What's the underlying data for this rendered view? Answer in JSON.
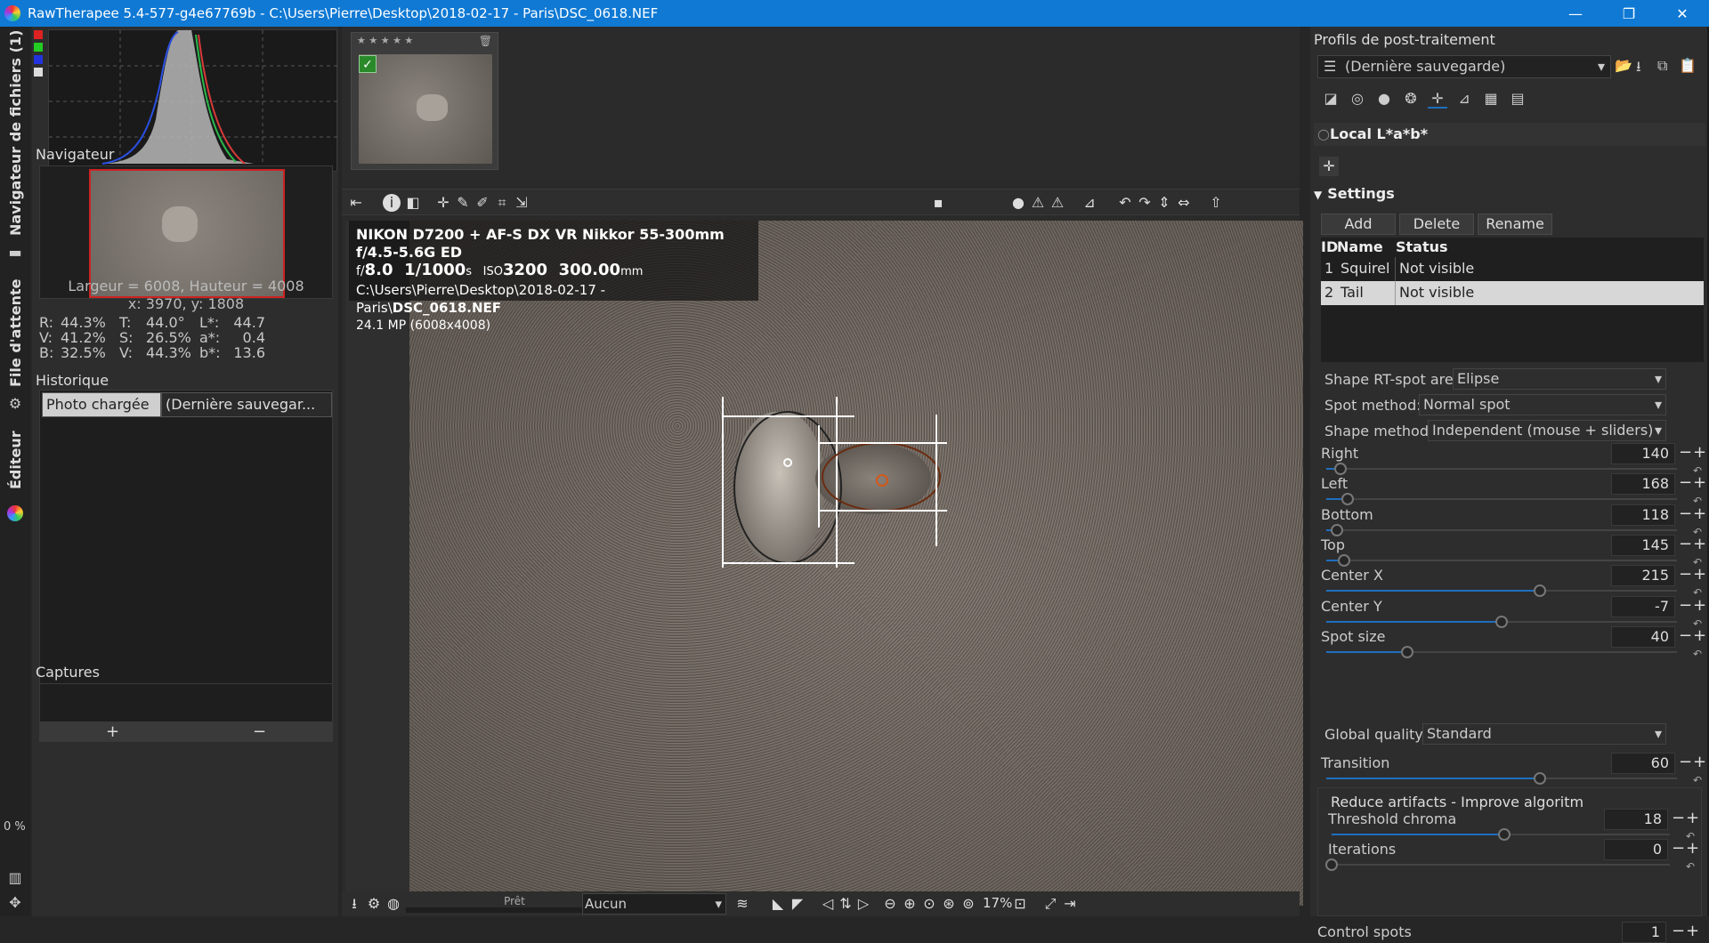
{
  "window": {
    "title": "RawTherapee 5.4-577-g4e67769b - C:\\Users\\Pierre\\Desktop\\2018-02-17 - Paris\\DSC_0618.NEF",
    "minimize": "—",
    "maximize": "❐",
    "close": "✕"
  },
  "side_tabs": {
    "browser": "Navigateur de fichiers (1)",
    "queue": "File d'attente",
    "editor": "Éditeur",
    "progress": "0 %"
  },
  "left": {
    "navigator_title": "Navigateur",
    "dims": "Largeur = 6008, Hauteur = 4008",
    "coords": "x: 3970, y: 1808",
    "pixel_rgb": [
      {
        "k": "R:",
        "v": "44.3%"
      },
      {
        "k": "V:",
        "v": "41.2%"
      },
      {
        "k": "B:",
        "v": "32.5%"
      }
    ],
    "pixel_hsv": [
      {
        "k": "T:",
        "v": "44.0°"
      },
      {
        "k": "S:",
        "v": "26.5%"
      },
      {
        "k": "V:",
        "v": "44.3%"
      }
    ],
    "pixel_lab": [
      {
        "k": "L*:",
        "v": "44.7"
      },
      {
        "k": "a*:",
        "v": "0.4"
      },
      {
        "k": "b*:",
        "v": "13.6"
      }
    ],
    "history_title": "Historique",
    "history_row": {
      "action": "Photo chargée",
      "value": "(Dernière sauvegar..."
    },
    "captures_title": "Captures",
    "add": "+",
    "remove": "−"
  },
  "filmstrip": {
    "stars": "★ ★ ★ ★ ★",
    "trash": "🗑"
  },
  "exif": {
    "camera": "NIKON D7200 + AF-S DX VR Nikkor 55-300mm f/4.5-5.6G ED",
    "f_prefix": "f/",
    "f_value": "8.0",
    "shutter": "1/1000",
    "shutter_unit": "s",
    "iso_label": "ISO",
    "iso": "3200",
    "focal": "300.00",
    "focal_unit": "mm",
    "path": "C:\\Users\\Pierre\\Desktop\\2018-02-17 - Paris\\",
    "filename": "DSC_0618.NEF",
    "mp": "24.1 MP (6008x4008)"
  },
  "status": {
    "ready": "Prêt",
    "output": "Aucun",
    "zoom": "17%"
  },
  "right": {
    "profiles_title": "Profils de post-traitement",
    "profile": "(Dernière sauvegarde)",
    "tool_title": "Local L*a*b*",
    "settings": "Settings",
    "buttons": [
      "Add",
      "Delete",
      "Rename"
    ],
    "table_headers": [
      "ID",
      "Name",
      "Status"
    ],
    "table_rows": [
      {
        "id": "1",
        "name": "Squirel",
        "status": "Not visible"
      },
      {
        "id": "2",
        "name": "Tail",
        "status": "Not visible"
      }
    ],
    "shape_area_label": "Shape RT-spot area:",
    "shape_area": "Elipse",
    "spot_method_label": "Spot method:",
    "spot_method": "Normal spot",
    "shape_method_label": "Shape method:",
    "shape_method": "Independent (mouse + sliders)",
    "sliders": [
      {
        "label": "Right",
        "value": "140",
        "pos": 0.04
      },
      {
        "label": "Left",
        "value": "168",
        "pos": 0.06
      },
      {
        "label": "Bottom",
        "value": "118",
        "pos": 0.03
      },
      {
        "label": "Top",
        "value": "145",
        "pos": 0.05
      },
      {
        "label": "Center X",
        "value": "215",
        "pos": 0.61
      },
      {
        "label": "Center Y",
        "value": "-7",
        "pos": 0.5
      },
      {
        "label": "Spot size",
        "value": "40",
        "pos": 0.23
      }
    ],
    "global_quality_label": "Global quality:",
    "global_quality": "Standard",
    "transition": {
      "label": "Transition",
      "value": "60",
      "pos": 0.61
    },
    "reduce_artifacts": "Reduce artifacts - Improve algoritm",
    "threshold": {
      "label": "Threshold chroma",
      "value": "18",
      "pos": 0.51
    },
    "iterations": {
      "label": "Iterations",
      "value": "0",
      "pos": 0.0
    },
    "control_spots": {
      "label": "Control spots",
      "value": "1"
    }
  },
  "colors": {
    "titlebar": "#0f79d4",
    "selected_row": "#d7d7d7",
    "slider_fill": "#1e6fbf"
  }
}
